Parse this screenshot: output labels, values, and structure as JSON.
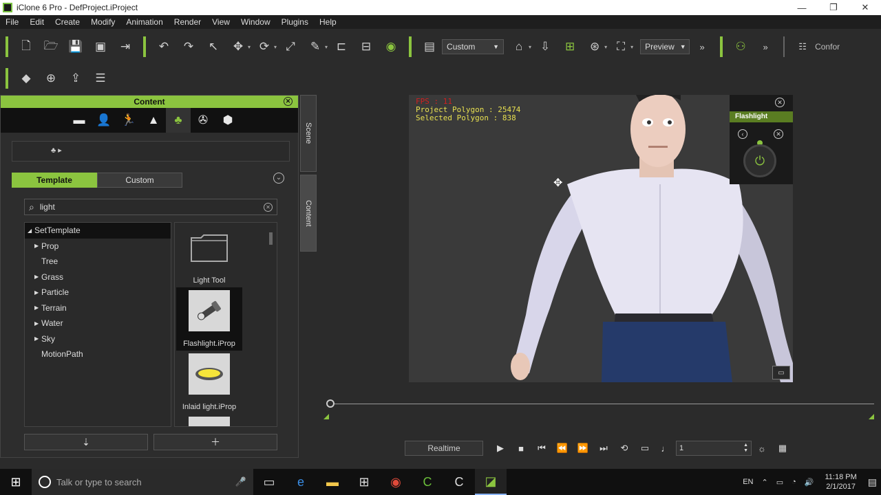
{
  "window": {
    "title": "iClone 6 Pro - DefProject.iProject"
  },
  "menu": [
    "File",
    "Edit",
    "Create",
    "Modify",
    "Animation",
    "Render",
    "View",
    "Window",
    "Plugins",
    "Help"
  ],
  "toolbar": {
    "camera_select": "Custom",
    "preview_select": "Preview",
    "conform_label": "Confor"
  },
  "content_panel": {
    "header": "Content",
    "lib_tabs": {
      "template": "Template",
      "custom": "Custom"
    },
    "search_value": "light",
    "tree": [
      {
        "label": "SetTemplate",
        "root": true
      },
      {
        "label": "Prop",
        "expandable": true
      },
      {
        "label": "Tree",
        "expandable": false
      },
      {
        "label": "Grass",
        "expandable": true
      },
      {
        "label": "Particle",
        "expandable": true
      },
      {
        "label": "Terrain",
        "expandable": true
      },
      {
        "label": "Water",
        "expandable": true
      },
      {
        "label": "Sky",
        "expandable": true
      },
      {
        "label": "MotionPath",
        "expandable": false
      }
    ],
    "thumbs": [
      {
        "label": "Light Tool"
      },
      {
        "label": "Flashlight.iProp"
      },
      {
        "label": "Inlaid light.iProp"
      }
    ]
  },
  "side_tabs": {
    "scene": "Scene",
    "content": "Content"
  },
  "viewport": {
    "fps": "FPS : 11",
    "project_polygon": "Project Polygon : 25474",
    "selected_polygon": "Selected Polygon : 838",
    "flashlight_title": "Flashlight"
  },
  "playback": {
    "realtime": "Realtime",
    "frame": "1"
  },
  "taskbar": {
    "search_placeholder": "Talk or type to search",
    "lang": "EN",
    "time": "11:18 PM",
    "date": "2/1/2017"
  },
  "colors": {
    "accent": "#8bc43f",
    "panel_bg": "#2d2d2d",
    "viewport_bg": "#3a3a3a"
  }
}
